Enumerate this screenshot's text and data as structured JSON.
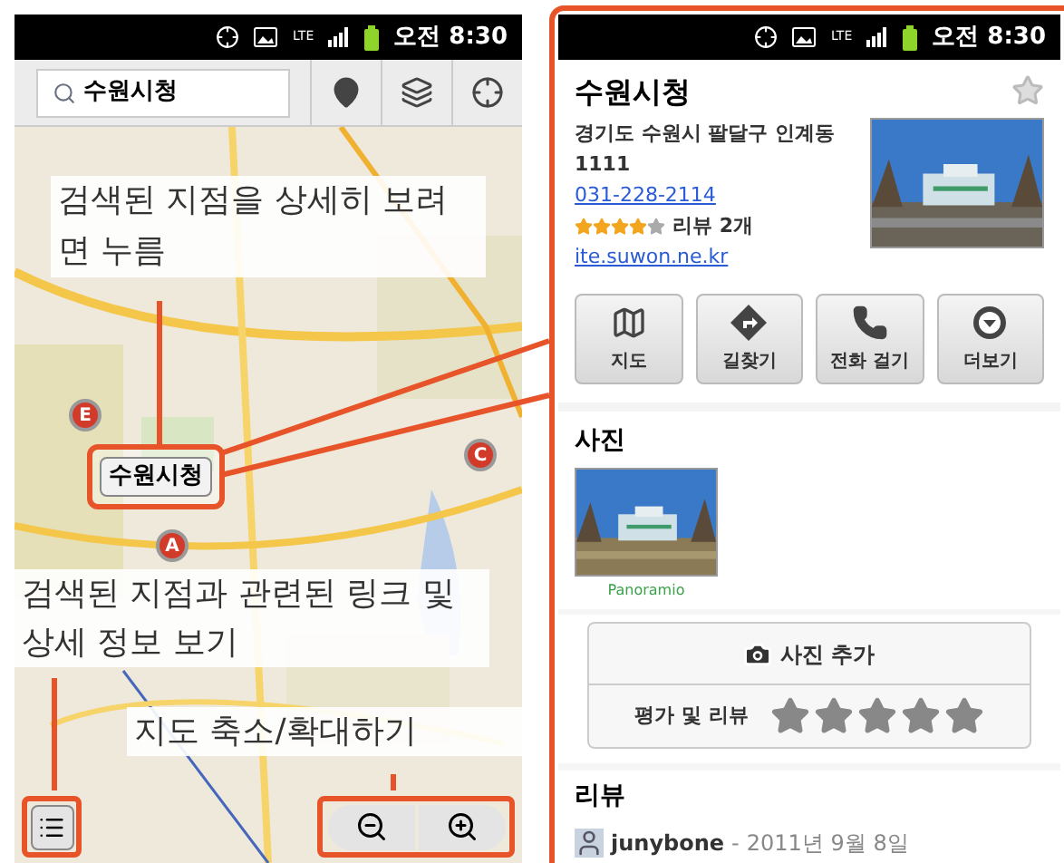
{
  "map_screen": {
    "status_bar": {
      "network": "LTE",
      "time": "오전 8:30"
    },
    "search": {
      "value": "수원시청"
    },
    "map": {
      "kind": "picture",
      "place_label": "수원시청",
      "markers": [
        {
          "label": "C"
        },
        {
          "label": "E"
        },
        {
          "label": "A"
        }
      ]
    },
    "callouts": [
      {
        "text": "검색된 지점을 상세히 보려면 누름"
      },
      {
        "text": "검색된 지점과 관련된 링크 및 상세 정보 보기"
      },
      {
        "text": "지도 축소/확대하기"
      }
    ]
  },
  "detail_screen": {
    "status_bar": {
      "network": "LTE",
      "time": "오전 8:30"
    },
    "title": "수원시청",
    "starred": false,
    "address": "경기도 수원시 팔달구 인계동 1111",
    "phone": "031-228-2114",
    "stars": 4,
    "review_count": "리뷰 2개",
    "website": "ite.suwon.ne.kr",
    "actions": [
      {
        "kind": "map",
        "label": "지도"
      },
      {
        "kind": "directions",
        "label": "길찾기"
      },
      {
        "kind": "call",
        "label": "전화 걸기"
      },
      {
        "kind": "more",
        "label": "더보기"
      }
    ],
    "photos": {
      "heading": "사진",
      "source": "Panoramio"
    },
    "add_photo": "사진 추가",
    "rate_label": "평가 및 리뷰",
    "reviews": {
      "heading": "리뷰",
      "items": [
        {
          "author": "junybone",
          "separator": "-",
          "date": "2011년 9월 8일"
        }
      ]
    }
  }
}
